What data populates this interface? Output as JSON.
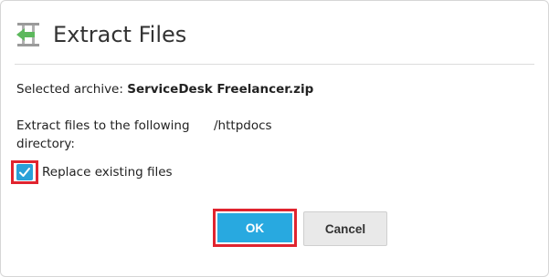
{
  "dialog": {
    "title": "Extract Files",
    "icon": "extract-arrow-icon"
  },
  "archive": {
    "label": "Selected archive:",
    "value": "ServiceDesk Freelancer.zip"
  },
  "directory": {
    "label": "Extract files to the following directory:",
    "value": "/httpdocs"
  },
  "replace": {
    "label": "Replace existing files",
    "checked": true
  },
  "buttons": {
    "ok": "OK",
    "cancel": "Cancel"
  },
  "colors": {
    "accent": "#28a9e0",
    "checkbox": "#2aa0d8",
    "highlight": "#e0242f",
    "icon_green": "#5cb85c"
  }
}
